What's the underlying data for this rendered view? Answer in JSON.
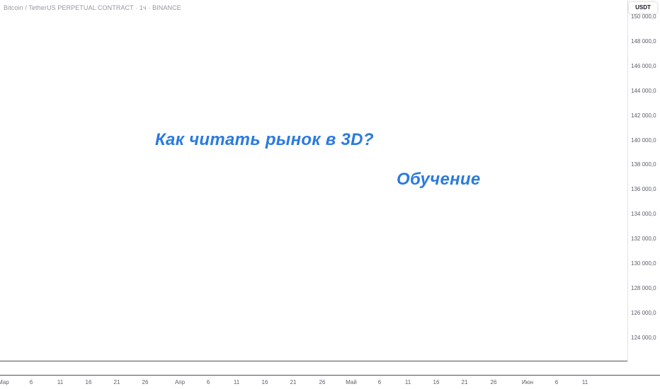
{
  "header": {
    "symbol_title": "Bitcoin / TetherUS PERPETUAL CONTRACT · 1ч · BINANCE"
  },
  "price_axis": {
    "currency": "USDT",
    "labels": [
      "150 000,0",
      "148 000,0",
      "146 000,0",
      "144 000,0",
      "142 000,0",
      "140 000,0",
      "138 000,0",
      "136 000,0",
      "134 000,0",
      "132 000,0",
      "130 000,0",
      "128 000,0",
      "126 000,0",
      "124 000,0"
    ]
  },
  "time_axis": {
    "labels": [
      "Мар",
      "6",
      "11",
      "16",
      "21",
      "26",
      "Апр",
      "6",
      "11",
      "16",
      "21",
      "26",
      "Май",
      "6",
      "11",
      "16",
      "21",
      "26",
      "Июн",
      "6",
      "11"
    ]
  },
  "annotations": {
    "headline": "Как читать рынок в 3D?",
    "subheadline": "Обучение"
  },
  "colors": {
    "annotation_text": "#2b7ae0",
    "axis_text": "#5d606b",
    "background": "#ffffff"
  }
}
